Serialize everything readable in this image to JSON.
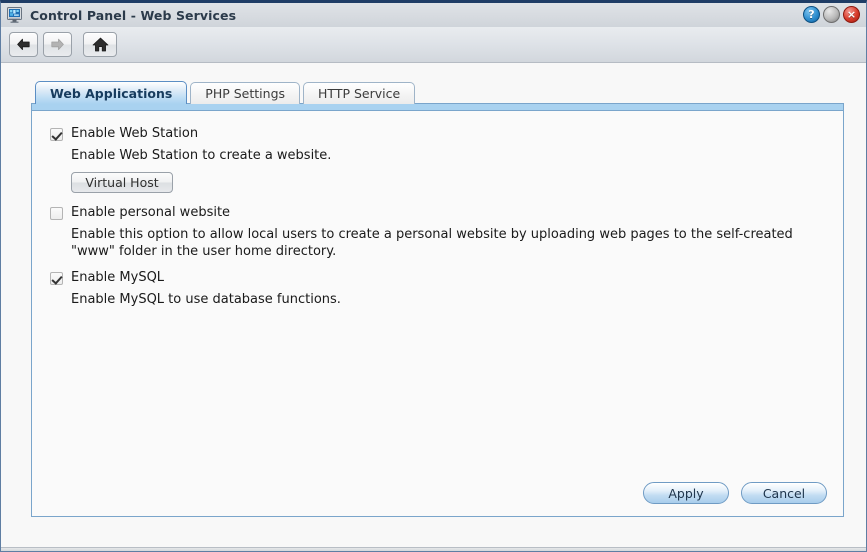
{
  "window": {
    "title": "Control Panel - Web Services",
    "icon": "control-panel-icon",
    "buttons": {
      "help": "?",
      "minimize": "",
      "close": "×"
    }
  },
  "toolbar": {
    "back": "back-arrow-icon",
    "forward": "forward-arrow-icon",
    "home": "home-icon"
  },
  "tabs": [
    {
      "label": "Web Applications",
      "active": true
    },
    {
      "label": "PHP Settings",
      "active": false
    },
    {
      "label": "HTTP Service",
      "active": false
    }
  ],
  "options": [
    {
      "label": "Enable Web Station",
      "checked": true,
      "description": "Enable Web Station to create a website.",
      "button": "Virtual Host"
    },
    {
      "label": "Enable personal website",
      "checked": false,
      "description": "Enable this option to allow local users to create a personal website by uploading web pages to the self-created \"www\" folder in the user home directory."
    },
    {
      "label": "Enable MySQL",
      "checked": true,
      "description": "Enable MySQL to use database functions."
    }
  ],
  "footer": {
    "apply": "Apply",
    "cancel": "Cancel"
  },
  "colors": {
    "accent": "#a9d2f0",
    "panel_border": "#7aa5cb",
    "title_border": "#1f3d66",
    "close_red": "#d93b2b",
    "help_blue": "#2f8fd0"
  }
}
